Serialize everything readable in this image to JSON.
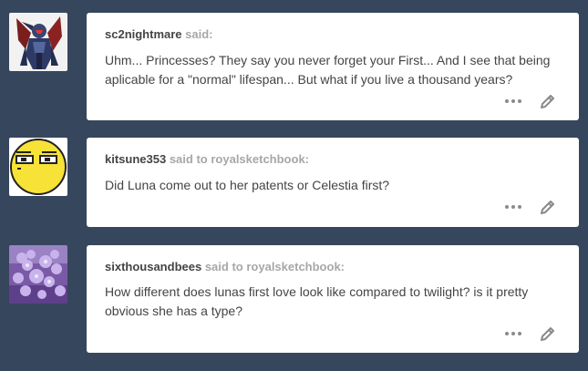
{
  "colors": {
    "background": "#36465d",
    "card": "#ffffff",
    "asker_name": "#444444",
    "said": "#a7a7a7",
    "icon": "#8a8a8a"
  },
  "posts": [
    {
      "asker": "sc2nightmare",
      "said": "said:",
      "target": "",
      "question": "Uhm... Princesses? They say you never forget your First... And I see that being aplicable for a \"normal\" lifespan... But what if you live a thousand years?",
      "avatar_icon": "armored-figure-avatar",
      "more_icon": "more-options-icon",
      "edit_icon": "pencil-icon"
    },
    {
      "asker": "kitsune353",
      "said": "said to",
      "target": "royalsketchbook:",
      "question": "Did Luna come out to her patents or Celestia first?",
      "avatar_icon": "yellow-face-avatar",
      "more_icon": "more-options-icon",
      "edit_icon": "pencil-icon"
    },
    {
      "asker": "sixthousandbees",
      "said": "said to",
      "target": "royalsketchbook:",
      "question": "How different does lunas first love look like compared to twilight? is it pretty obvious she has a type?",
      "avatar_icon": "lilac-flower-avatar",
      "more_icon": "more-options-icon",
      "edit_icon": "pencil-icon"
    }
  ]
}
